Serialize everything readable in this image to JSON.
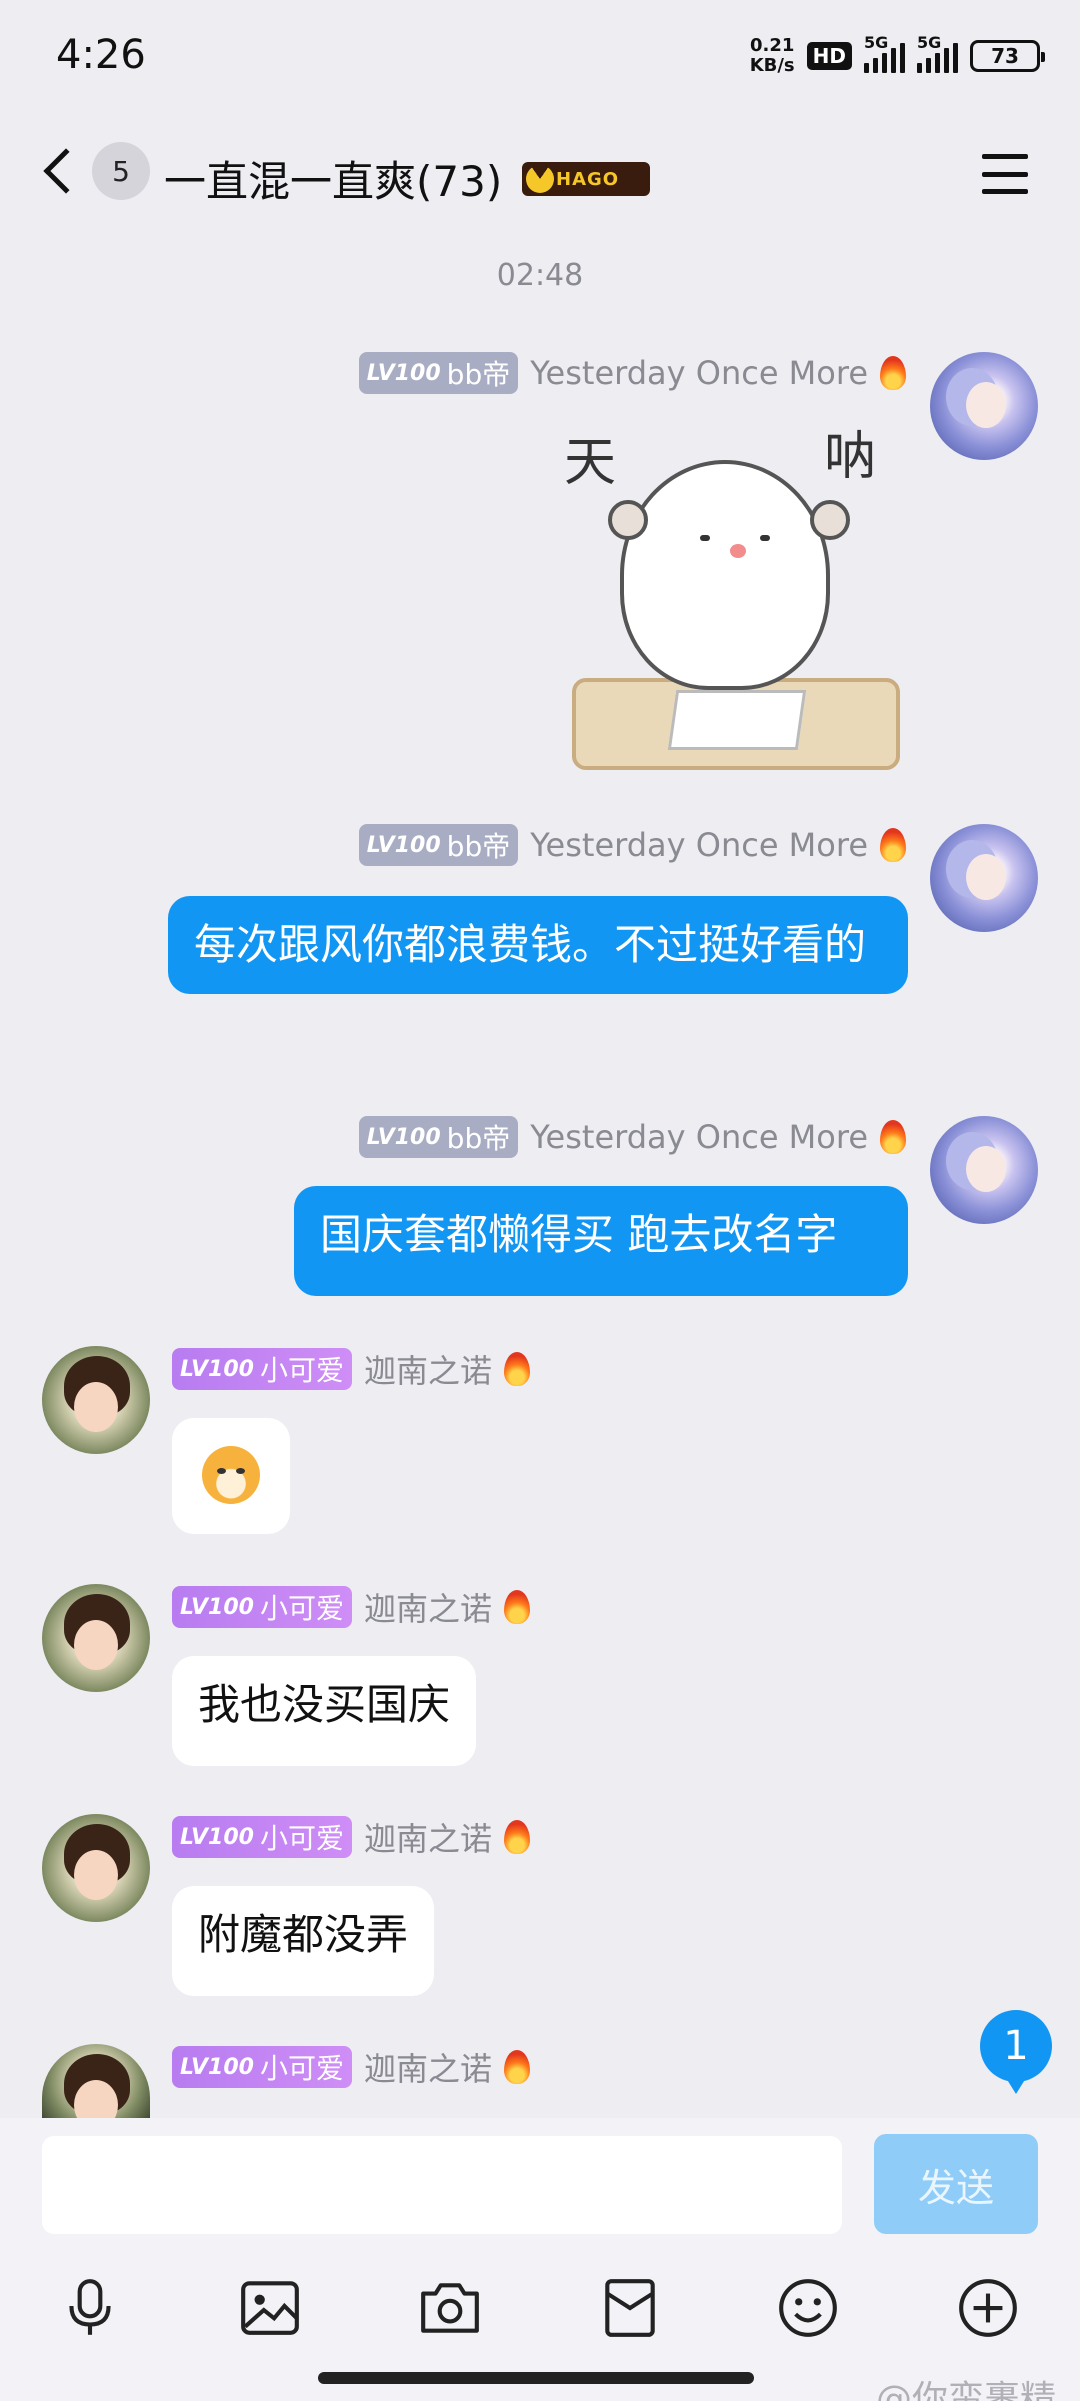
{
  "status_bar": {
    "time": "4:26",
    "net_speed": "0.21",
    "net_speed_unit": "KB/s",
    "hd": "HD",
    "sim1": "5G",
    "sim2": "5G",
    "battery": "73"
  },
  "header": {
    "unread_count": "5",
    "title": "一直混一直爽(73)",
    "badge_text": "HAGO"
  },
  "timestamp": "02:48",
  "messages": [
    {
      "level": "LV100",
      "title": "bb帝",
      "sender": "Yesterday Once More",
      "type": "sticker",
      "sticker_chars": [
        "天",
        "呐"
      ]
    },
    {
      "level": "LV100",
      "title": "bb帝",
      "sender": "Yesterday Once More",
      "type": "text",
      "text": "每次跟风你都浪费钱。不过挺好看的"
    },
    {
      "level": "LV100",
      "title": "bb帝",
      "sender": "Yesterday Once More",
      "type": "text",
      "text": "国庆套都懒得买 跑去改名字"
    },
    {
      "level": "LV100",
      "title": "小可爱",
      "sender": "迦南之诺",
      "type": "emoji"
    },
    {
      "level": "LV100",
      "title": "小可爱",
      "sender": "迦南之诺",
      "type": "text",
      "text": "我也没买国庆"
    },
    {
      "level": "LV100",
      "title": "小可爱",
      "sender": "迦南之诺",
      "type": "text",
      "text": "附魔都没弄"
    },
    {
      "level": "LV100",
      "title": "小可爱",
      "sender": "迦南之诺",
      "type": "partial"
    }
  ],
  "new_message_count": "1",
  "input": {
    "placeholder": "",
    "send_label": "发送"
  },
  "toolbar": [
    "microphone-icon",
    "image-icon",
    "camera-icon",
    "red-packet-icon",
    "emoji-icon",
    "plus-icon"
  ],
  "watermark": "@你蛮裹精",
  "colors": {
    "accent": "#1296f3",
    "background": "#ededf2",
    "send_disabled": "#8fcdf8",
    "level_gray": "#a9adc3",
    "level_purple": "#c084f2"
  }
}
